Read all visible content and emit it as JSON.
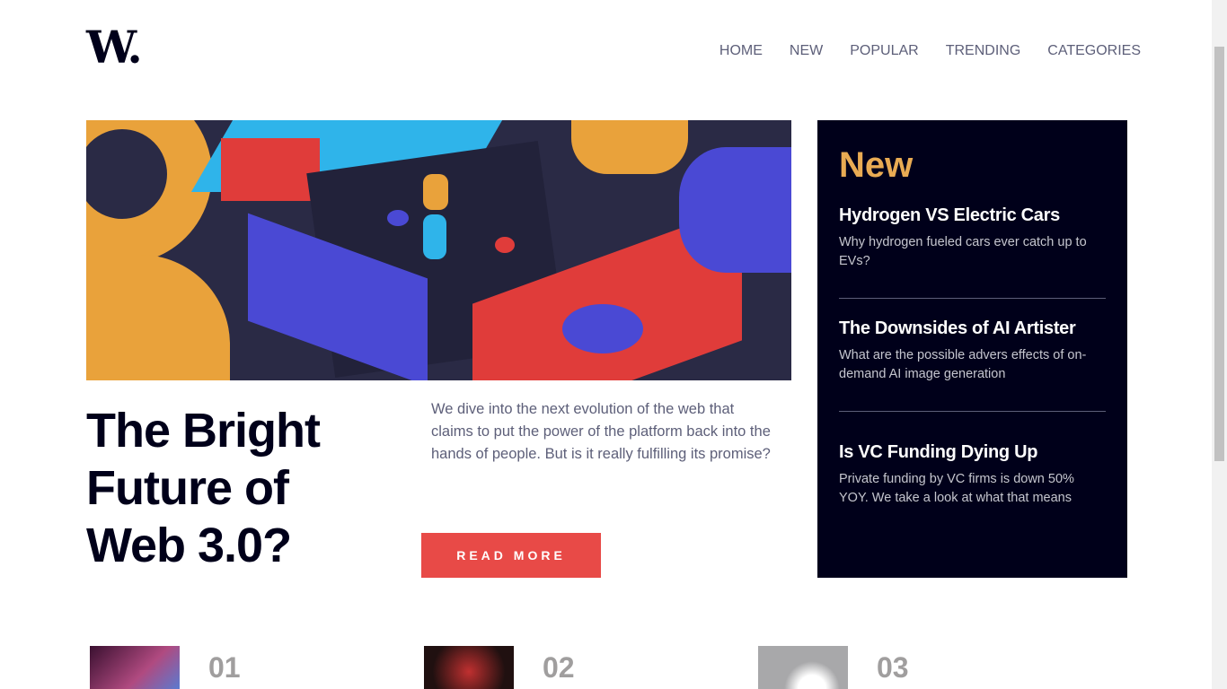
{
  "header": {
    "logo": "W.",
    "nav": [
      "HOME",
      "NEW",
      "POPULAR",
      "TRENDING",
      "CATEGORIES"
    ]
  },
  "hero": {
    "title": "The Bright Future of Web 3.0?",
    "description": "We dive into the next evolution of the web that claims to put the power of the platform back into the hands of people. But is it really fulfilling its promise?",
    "button": "READ MORE"
  },
  "new_panel": {
    "heading": "New",
    "items": [
      {
        "title": "Hydrogen VS Electric Cars",
        "text": "Why hydrogen fueled cars ever catch up to EVs?"
      },
      {
        "title": "The Downsides of AI Artister",
        "text": "What are the possible advers effects of on-demand AI image generation"
      },
      {
        "title": "Is VC Funding Dying Up",
        "text": "Private funding by VC firms is down 50% YOY. We take a look at what that means"
      }
    ]
  },
  "cards": [
    "01",
    "02",
    "03"
  ],
  "colors": {
    "accent": "#e84a47",
    "panel": "#00001a",
    "new": "#e9ab53"
  }
}
